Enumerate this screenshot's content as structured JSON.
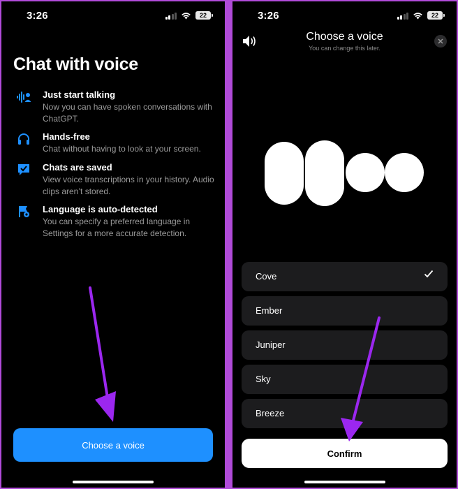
{
  "left_screen": {
    "status": {
      "time": "3:26",
      "battery": "22"
    },
    "title": "Chat with voice",
    "features": [
      {
        "icon": "voice-waveform-icon",
        "title": "Just start talking",
        "description": "Now you can have spoken conversations with ChatGPT."
      },
      {
        "icon": "headphones-icon",
        "title": "Hands-free",
        "description": "Chat without having to look at your screen."
      },
      {
        "icon": "chat-check-icon",
        "title": "Chats are saved",
        "description": "View voice transcriptions in your history. Audio clips aren’t stored."
      },
      {
        "icon": "flag-icon",
        "title": "Language is auto-detected",
        "description": "You can specify a preferred language in Settings for a more accurate detection."
      }
    ],
    "button_label": "Choose a voice"
  },
  "right_screen": {
    "status": {
      "time": "3:26",
      "battery": "22"
    },
    "title": "Choose a voice",
    "subtitle": "You can change this later.",
    "voices": [
      {
        "name": "Cove",
        "selected": true
      },
      {
        "name": "Ember",
        "selected": false
      },
      {
        "name": "Juniper",
        "selected": false
      },
      {
        "name": "Sky",
        "selected": false
      },
      {
        "name": "Breeze",
        "selected": false
      }
    ],
    "confirm_label": "Confirm"
  },
  "colors": {
    "accent_blue": "#1e90ff",
    "annotation_purple": "#9b27ef",
    "frame_border": "#b04bd8",
    "option_bg": "#1c1c1e"
  }
}
